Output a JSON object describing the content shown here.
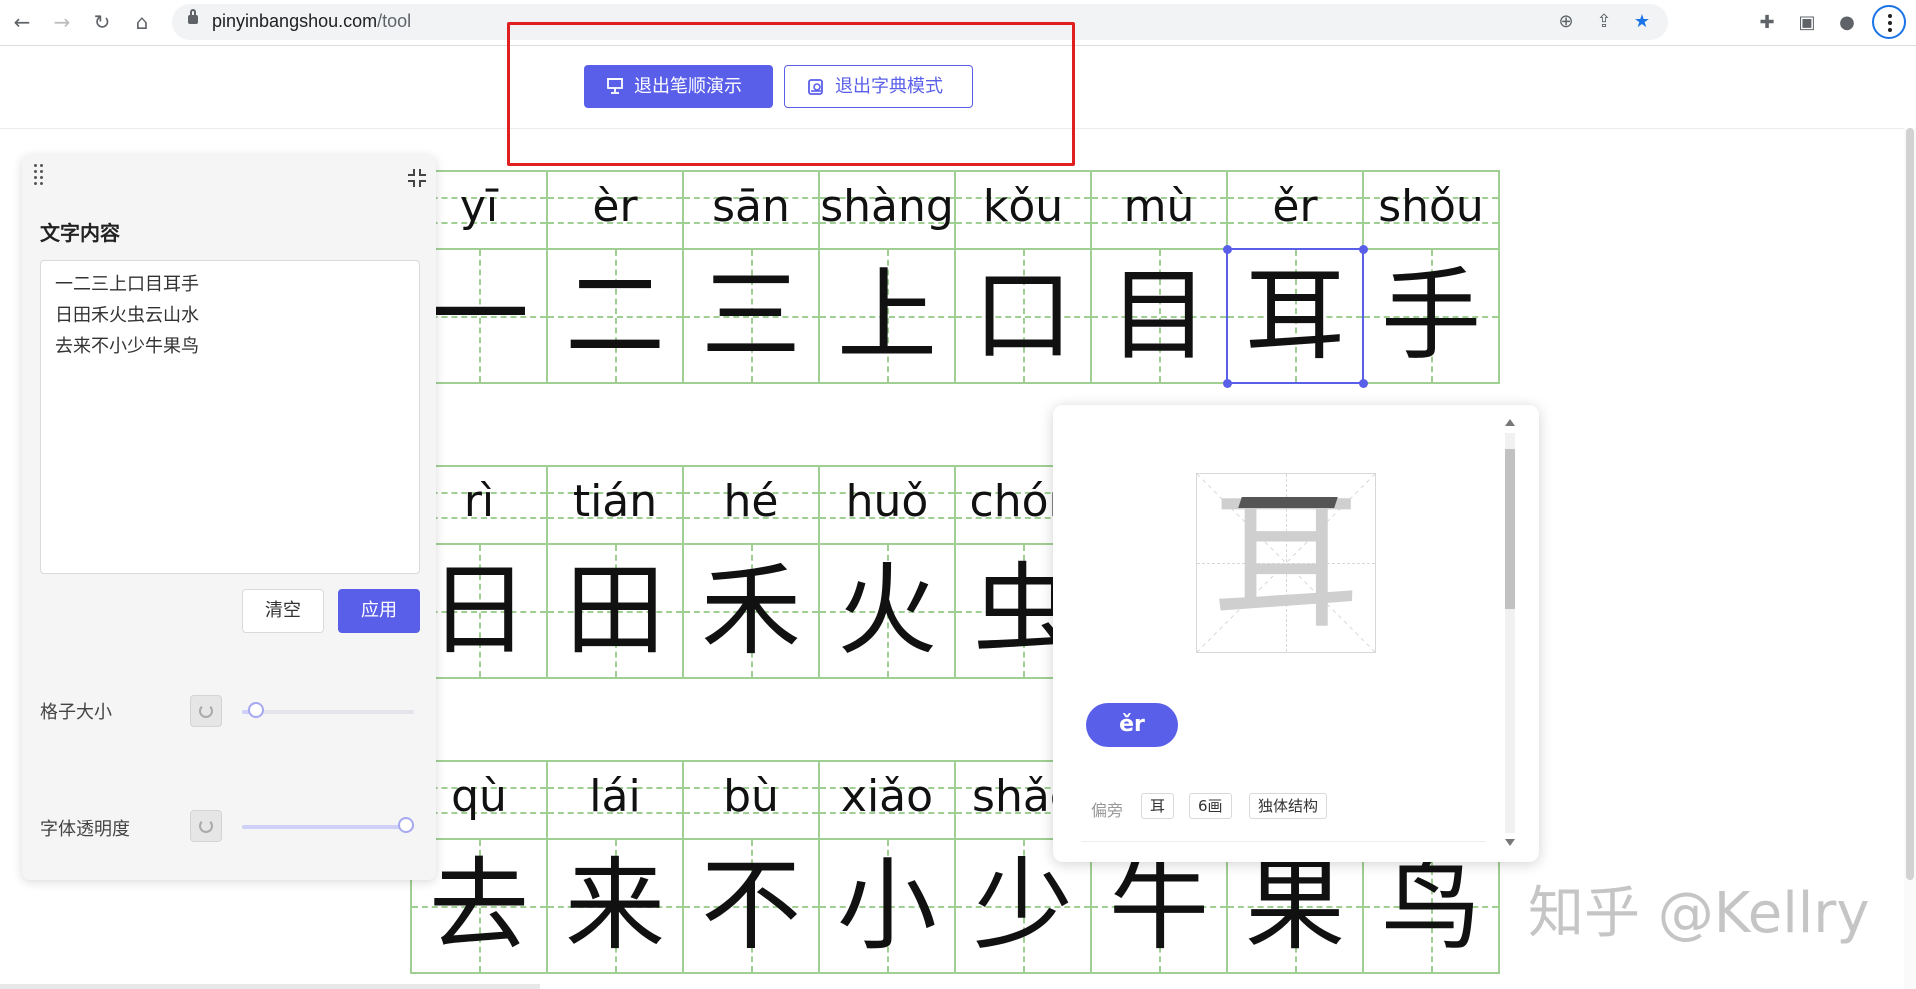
{
  "browser": {
    "url_domain": "pinyinbangshou.com",
    "url_path": "/tool",
    "nav_icons": [
      "back-icon",
      "forward-icon",
      "reload-icon",
      "home-icon"
    ]
  },
  "header": {
    "stroke_demo_label": "退出笔顺演示",
    "dictionary_mode_label": "退出字典模式"
  },
  "grid": {
    "rows": [
      {
        "pinyin": [
          "yī",
          "èr",
          "sān",
          "shàng",
          "kǒu",
          "mù",
          "ěr",
          "shǒu"
        ],
        "hanzi": [
          "一",
          "二",
          "三",
          "上",
          "口",
          "目",
          "耳",
          "手"
        ]
      },
      {
        "pinyin": [
          "rì",
          "tián",
          "hé",
          "huǒ",
          "chón"
        ],
        "hanzi": [
          "日",
          "田",
          "禾",
          "火",
          "虫"
        ]
      },
      {
        "pinyin": [
          "qù",
          "lái",
          "bù",
          "xiǎo",
          "shǎc"
        ],
        "hanzi": [
          "去",
          "来",
          "不",
          "小",
          "少",
          "牛",
          "果",
          "鸟"
        ]
      }
    ],
    "selected": {
      "row": 0,
      "col": 6
    }
  },
  "panel": {
    "title": "文字内容",
    "text_lines": [
      "一二三上口目耳手",
      "日田禾火虫云山水",
      "去来不小少牛果鸟"
    ],
    "clear_label": "清空",
    "apply_label": "应用",
    "grid_size_label": "格子大小",
    "grid_size_value": 0.08,
    "font_opacity_label": "字体透明度",
    "font_opacity_value": 1.0
  },
  "popup": {
    "character": "耳",
    "pinyin": "ěr",
    "radical_label": "偏旁",
    "radical": "耳",
    "strokes": "6画",
    "structure": "独体结构"
  },
  "watermark": "知乎 @Kellry",
  "colors": {
    "accent": "#5a5fe9",
    "grid_green": "#9fcf92",
    "highlight_red": "#e02020"
  }
}
